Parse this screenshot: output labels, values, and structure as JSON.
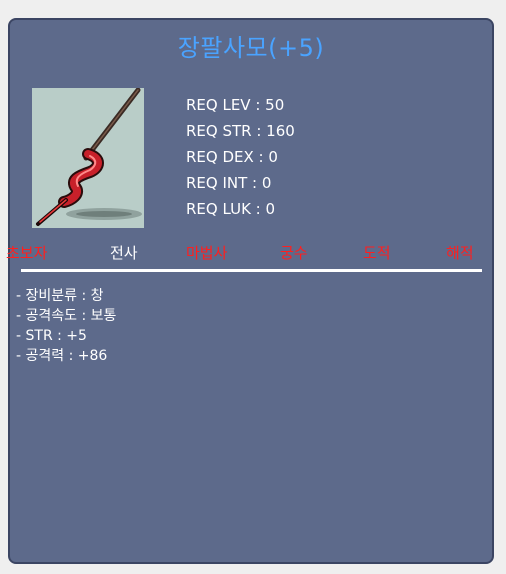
{
  "item": {
    "name": "장팔사모(+5)",
    "icon": "spear-icon"
  },
  "requirements": [
    "REQ LEV : 50",
    "REQ STR : 160",
    "REQ DEX : 0",
    "REQ INT : 0",
    "REQ LUK : 0"
  ],
  "jobs": [
    {
      "label": "초보자",
      "active": false
    },
    {
      "label": "전사",
      "active": true
    },
    {
      "label": "마법사",
      "active": false
    },
    {
      "label": "궁수",
      "active": false
    },
    {
      "label": "도적",
      "active": false
    },
    {
      "label": "해적",
      "active": false
    }
  ],
  "stats": [
    "- 장비분류 : 창",
    "- 공격속도 : 보통",
    "- STR : +5",
    "- 공격력 : +86"
  ],
  "colors": {
    "panel": "#5d6a8b",
    "title": "#4aa3ff",
    "job_unavailable": "#ff1f1f",
    "job_available": "#ffffff"
  }
}
